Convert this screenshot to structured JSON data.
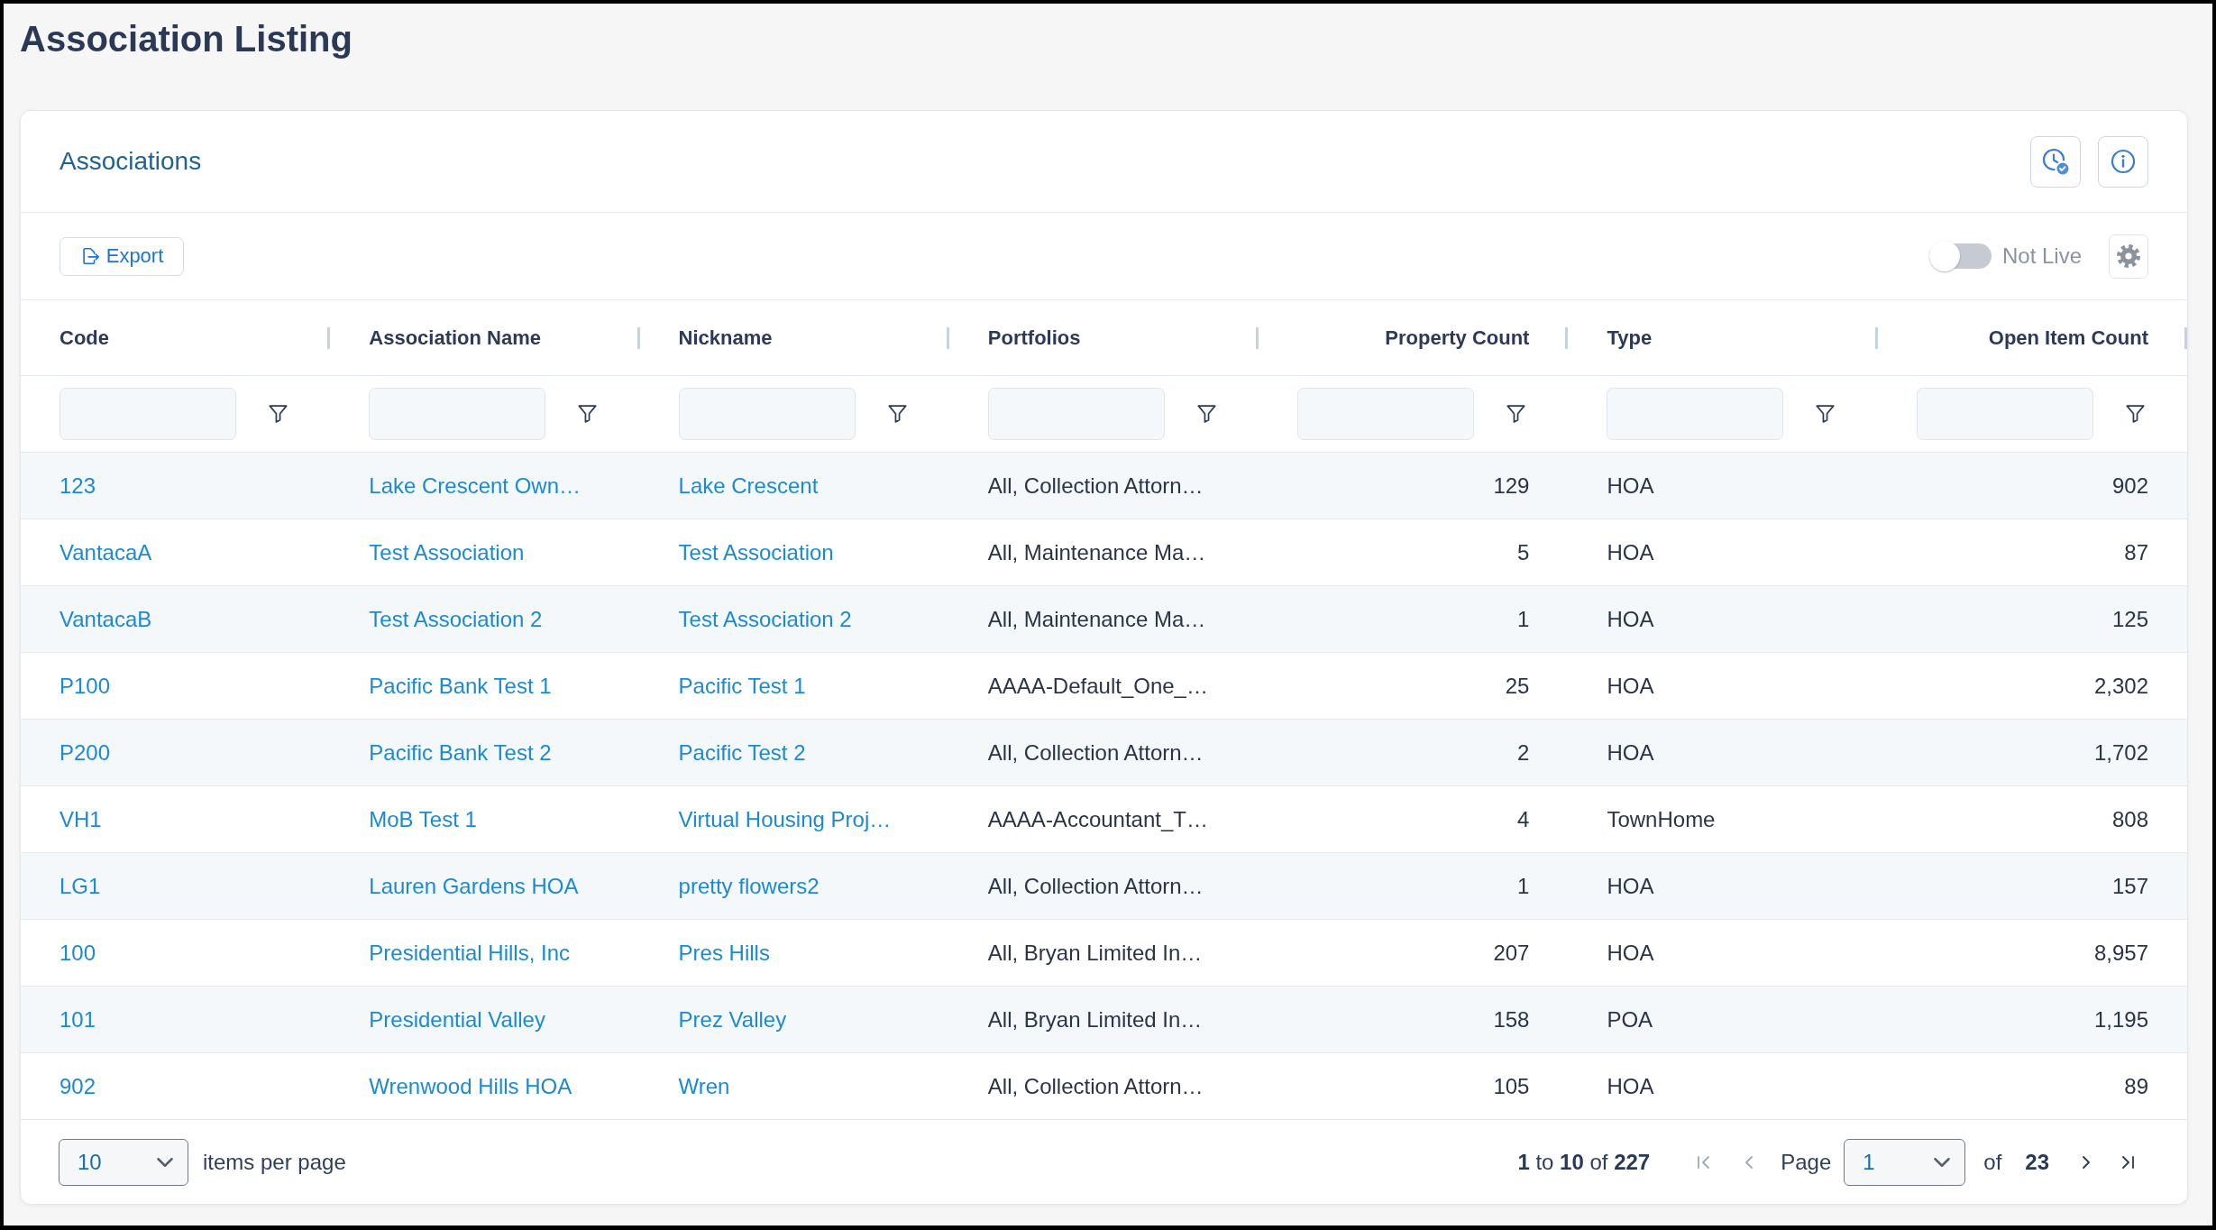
{
  "page": {
    "title": "Association Listing"
  },
  "card": {
    "title": "Associations",
    "export_button": {
      "label": "Export"
    },
    "live_toggle": {
      "label": "Not Live",
      "on": false
    },
    "table": {
      "columns": [
        {
          "label": "Code",
          "kind": "link",
          "filterable": true
        },
        {
          "label": "Association Name",
          "kind": "link",
          "filterable": true
        },
        {
          "label": "Nickname",
          "kind": "link",
          "filterable": true
        },
        {
          "label": "Portfolios",
          "kind": "text",
          "filterable": true
        },
        {
          "label": "Property Count",
          "kind": "number",
          "filterable": true
        },
        {
          "label": "Type",
          "kind": "text",
          "filterable": true
        },
        {
          "label": "Open Item Count",
          "kind": "number",
          "filterable": true
        }
      ],
      "rows": [
        [
          "123",
          "Lake Crescent Own…",
          "Lake Crescent",
          "All, Collection Attorn…",
          "129",
          "HOA",
          "902"
        ],
        [
          "VantacaA",
          "Test Association",
          "Test Association",
          "All, Maintenance Ma…",
          "5",
          "HOA",
          "87"
        ],
        [
          "VantacaB",
          "Test Association 2",
          "Test Association 2",
          "All, Maintenance Ma…",
          "1",
          "HOA",
          "125"
        ],
        [
          "P100",
          "Pacific Bank Test 1",
          "Pacific Test 1",
          "AAAA-Default_One_…",
          "25",
          "HOA",
          "2,302"
        ],
        [
          "P200",
          "Pacific Bank Test 2",
          "Pacific Test 2",
          "All, Collection Attorn…",
          "2",
          "HOA",
          "1,702"
        ],
        [
          "VH1",
          "MoB Test 1",
          "Virtual Housing Proj…",
          "AAAA-Accountant_T…",
          "4",
          "TownHome",
          "808"
        ],
        [
          "LG1",
          "Lauren Gardens HOA",
          "pretty flowers2",
          "All, Collection Attorn…",
          "1",
          "HOA",
          "157"
        ],
        [
          "100",
          "Presidential Hills, Inc",
          "Pres Hills",
          "All, Bryan Limited In…",
          "207",
          "HOA",
          "8,957"
        ],
        [
          "101",
          "Presidential Valley",
          "Prez Valley",
          "All, Bryan Limited In…",
          "158",
          "POA",
          "1,195"
        ],
        [
          "902",
          "Wrenwood Hills HOA",
          "Wren",
          "All, Collection Attorn…",
          "105",
          "HOA",
          "89"
        ]
      ]
    },
    "footer": {
      "page_size": {
        "value": "10"
      },
      "page_size_label": "items per page",
      "range": "**1** to **10** of **227**",
      "pager": [
        {
          "kind": "first",
          "disabled": true
        },
        {
          "kind": "previous",
          "disabled": true
        },
        {
          "kind": "label",
          "text": "Page"
        },
        {
          "kind": "select",
          "value": "1"
        },
        {
          "kind": "label",
          "text": "of"
        },
        {
          "kind": "count",
          "text": "23"
        },
        {
          "kind": "next",
          "disabled": false
        },
        {
          "kind": "last",
          "disabled": false
        }
      ]
    }
  }
}
